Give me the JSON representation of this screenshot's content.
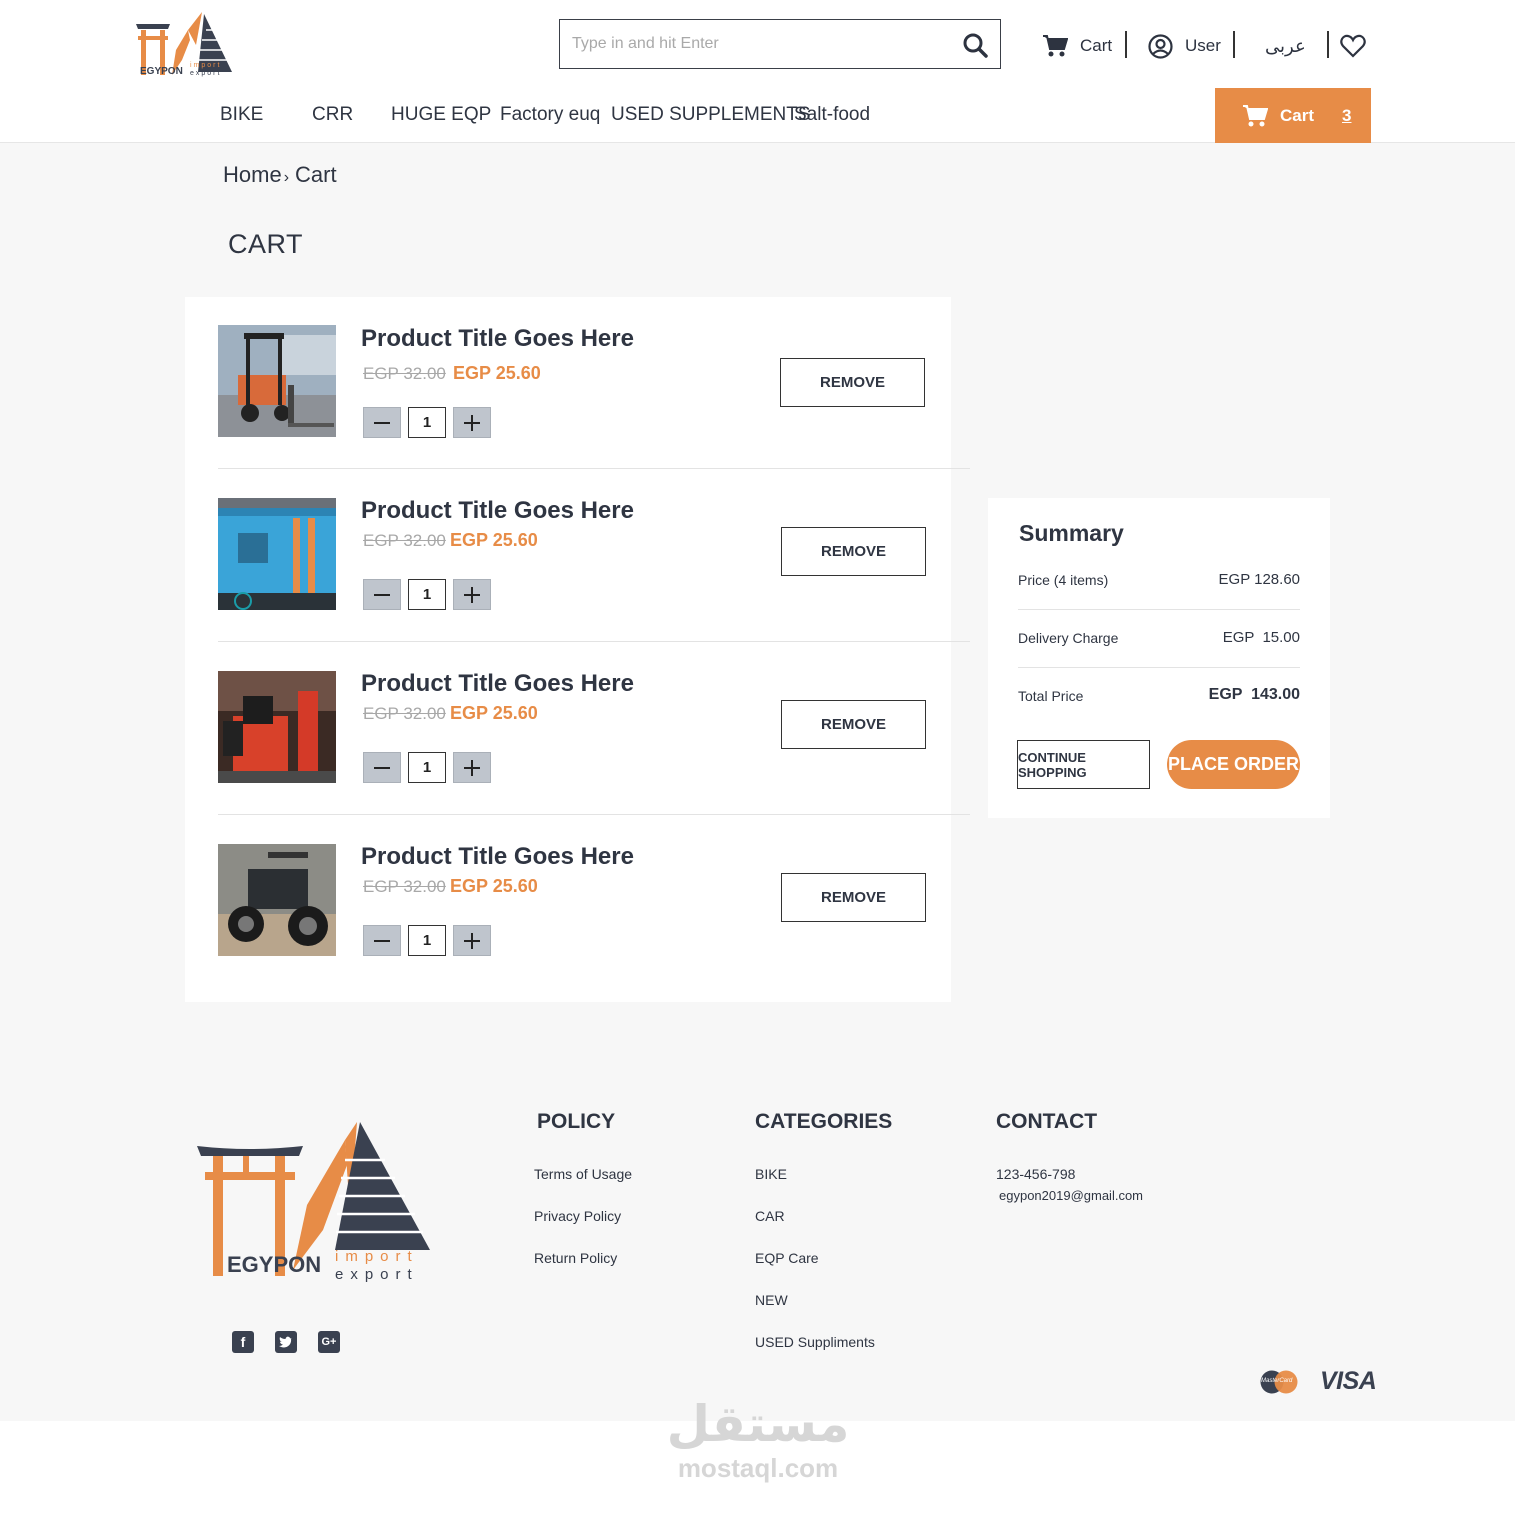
{
  "header": {
    "logo_name": "EGYPON",
    "logo_tagline_1": "import",
    "logo_tagline_2": "export",
    "search_placeholder": "Type in and hit Enter",
    "cart_label": "Cart",
    "user_label": "User",
    "language_label": "عربى",
    "categories": [
      "BIKE",
      "CRR",
      "HUGE EQP",
      "Factory euq",
      "USED SUPPLEMENTS",
      "Salt-food"
    ],
    "cart_button_label": "Cart",
    "cart_count": "3",
    "accent_color": "#e78c47"
  },
  "breadcrumb": {
    "home": "Home",
    "separator": "›",
    "current": "Cart"
  },
  "page_title": "CART",
  "cart": {
    "items": [
      {
        "title": "Product Title Goes Here",
        "old_price": "EGP 32.00",
        "new_price": "EGP 25.60",
        "quantity": "1",
        "remove_label": "REMOVE",
        "image": "forklift"
      },
      {
        "title": "Product Title Goes Here",
        "old_price": "EGP 32.00",
        "new_price": "EGP 25.60",
        "quantity": "1",
        "remove_label": "REMOVE",
        "image": "compressor"
      },
      {
        "title": "Product Title Goes Here",
        "old_price": "EGP 32.00",
        "new_price": "EGP 25.60",
        "quantity": "1",
        "remove_label": "REMOVE",
        "image": "tire-changer"
      },
      {
        "title": "Product Title Goes Here",
        "old_price": "EGP 32.00",
        "new_price": "EGP 25.60",
        "quantity": "1",
        "remove_label": "REMOVE",
        "image": "atv"
      }
    ]
  },
  "summary": {
    "title": "Summary",
    "price_label": "Price (4 items)",
    "price_value": "EGP 128.60",
    "delivery_label": "Delivery Charge",
    "delivery_value": "EGP  15.00",
    "total_label": "Total Price",
    "total_value": "EGP  143.00",
    "continue_label": "CONTINUE SHOPPING",
    "order_label": "PLACE ORDER"
  },
  "footer": {
    "policy": {
      "heading": "POLICY",
      "links": [
        "Terms of Usage",
        "Privacy Policy",
        "Return Policy"
      ]
    },
    "categories": {
      "heading": "CATEGORIES",
      "links": [
        "BIKE",
        "CAR",
        "EQP Care",
        "NEW",
        "USED Suppliments"
      ]
    },
    "contact": {
      "heading": "CONTACT",
      "phone": "123-456-798",
      "email": "egypon2019@gmail.com"
    },
    "social": [
      "facebook-icon",
      "twitter-icon",
      "google-plus-icon"
    ],
    "payment": {
      "mastercard_label": "MasterCard",
      "visa_label": "VISA"
    }
  },
  "watermark": {
    "arabic": "مستقل",
    "latin": "mostaql.com"
  }
}
